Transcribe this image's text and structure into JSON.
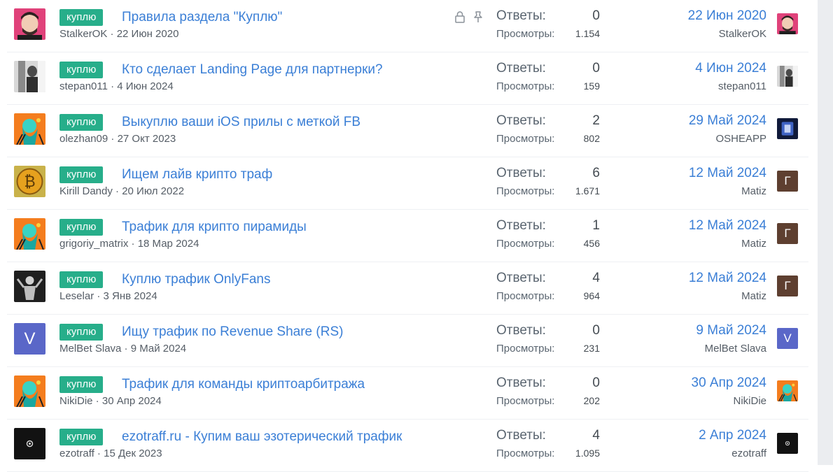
{
  "colors": {
    "tag_bg": "#27ae8a",
    "link": "#3b7fd6",
    "avatar_v": "#5a67c8",
    "avatar_g": "#5e3f30"
  },
  "labels": {
    "replies": "Ответы:",
    "views": "Просмотры:",
    "sep": " · "
  },
  "threads": [
    {
      "tag": "куплю",
      "title": "Правила раздела \"Куплю\"",
      "author": "StalkerOK",
      "date": "22 Июн 2020",
      "replies": "0",
      "views": "1.154",
      "last_date": "22 Июн 2020",
      "last_user": "StalkerOK",
      "avatar": "portrait-man",
      "last_avatar": "portrait-man",
      "locked": true,
      "pinned": true
    },
    {
      "tag": "куплю",
      "title": "Кто сделает Landing Page для партнерки?",
      "author": "stepan011",
      "date": "4 Июн 2024",
      "replies": "0",
      "views": "159",
      "last_date": "4 Июн 2024",
      "last_user": "stepan011",
      "avatar": "photo-grey",
      "last_avatar": "photo-grey"
    },
    {
      "tag": "куплю",
      "title": "Выкуплю ваши iOS прилы с меткой FB",
      "author": "olezhan09",
      "date": "27 Окт 2023",
      "replies": "2",
      "views": "802",
      "last_date": "29 Май 2024",
      "last_user": "OSHEAPP",
      "avatar": "default-orange",
      "last_avatar": "app-blue"
    },
    {
      "tag": "куплю",
      "title": "Ищем лайв крипто траф",
      "author": "Kirill Dandy",
      "date": "20 Июл 2022",
      "replies": "6",
      "views": "1.671",
      "last_date": "12 Май 2024",
      "last_user": "Matiz",
      "avatar": "bitcoin",
      "last_avatar": "letter",
      "last_letter": "Г"
    },
    {
      "tag": "куплю",
      "title": "Трафик для крипто пирамиды",
      "author": "grigoriy_matrix",
      "date": "18 Мар 2024",
      "replies": "1",
      "views": "456",
      "last_date": "12 Май 2024",
      "last_user": "Matiz",
      "avatar": "default-orange",
      "last_avatar": "letter",
      "last_letter": "Г"
    },
    {
      "tag": "куплю",
      "title": "Куплю трафик OnlyFans",
      "author": "Leselar",
      "date": "3 Янв 2024",
      "replies": "4",
      "views": "964",
      "last_date": "12 Май 2024",
      "last_user": "Matiz",
      "avatar": "dark-figure",
      "last_avatar": "letter",
      "last_letter": "Г"
    },
    {
      "tag": "куплю",
      "title": "Ищу трафик по Revenue Share (RS)",
      "author": "MelBet Slava",
      "date": "9 Май 2024",
      "replies": "0",
      "views": "231",
      "last_date": "9 Май 2024",
      "last_user": "MelBet Slava",
      "avatar": "letter-v",
      "letter": "V",
      "last_avatar": "letter-v",
      "last_letter": "V"
    },
    {
      "tag": "куплю",
      "title": "Трафик для команды криптоарбитража",
      "author": "NikiDie",
      "date": "30 Апр 2024",
      "replies": "0",
      "views": "202",
      "last_date": "30 Апр 2024",
      "last_user": "NikiDie",
      "avatar": "default-orange",
      "last_avatar": "default-orange"
    },
    {
      "tag": "куплю",
      "title": "ezotraff.ru - Купим ваш эзотерический трафик",
      "author": "ezotraff",
      "date": "15 Дек 2023",
      "replies": "4",
      "views": "1.095",
      "last_date": "2 Апр 2024",
      "last_user": "ezotraff",
      "avatar": "dark-logo",
      "last_avatar": "dark-logo"
    }
  ]
}
